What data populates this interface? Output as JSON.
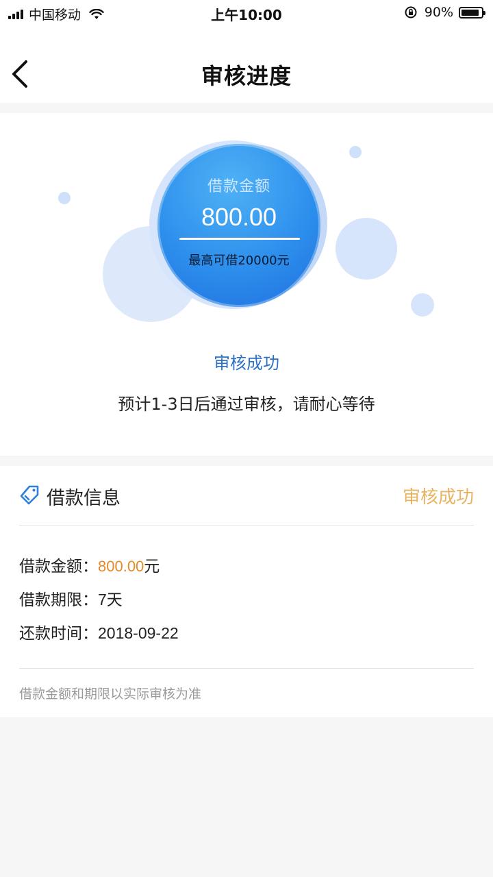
{
  "status_bar": {
    "carrier": "中国移动",
    "time": "上午10:00",
    "battery": "90%",
    "battery_level": 0.9
  },
  "nav": {
    "title": "审核进度"
  },
  "hero": {
    "amount_label": "借款金额",
    "amount": "800.00",
    "max_text": "最高可借20000元",
    "status": "审核成功",
    "hint": "预计1-3日后通过审核，请耐心等待"
  },
  "info": {
    "title": "借款信息",
    "status": "审核成功",
    "rows": [
      {
        "label": "借款金额：",
        "value": "800.00",
        "unit": "元"
      },
      {
        "label": "借款期限：",
        "value": "7天"
      },
      {
        "label": "还款时间：",
        "value": "2018-09-22"
      }
    ],
    "note": "借款金额和期限以实际审核为准"
  },
  "colors": {
    "primary": "#2d8fec",
    "status_blue": "#2a6fc9",
    "status_gold": "#e8b464",
    "amount_orange": "#e58a27"
  }
}
